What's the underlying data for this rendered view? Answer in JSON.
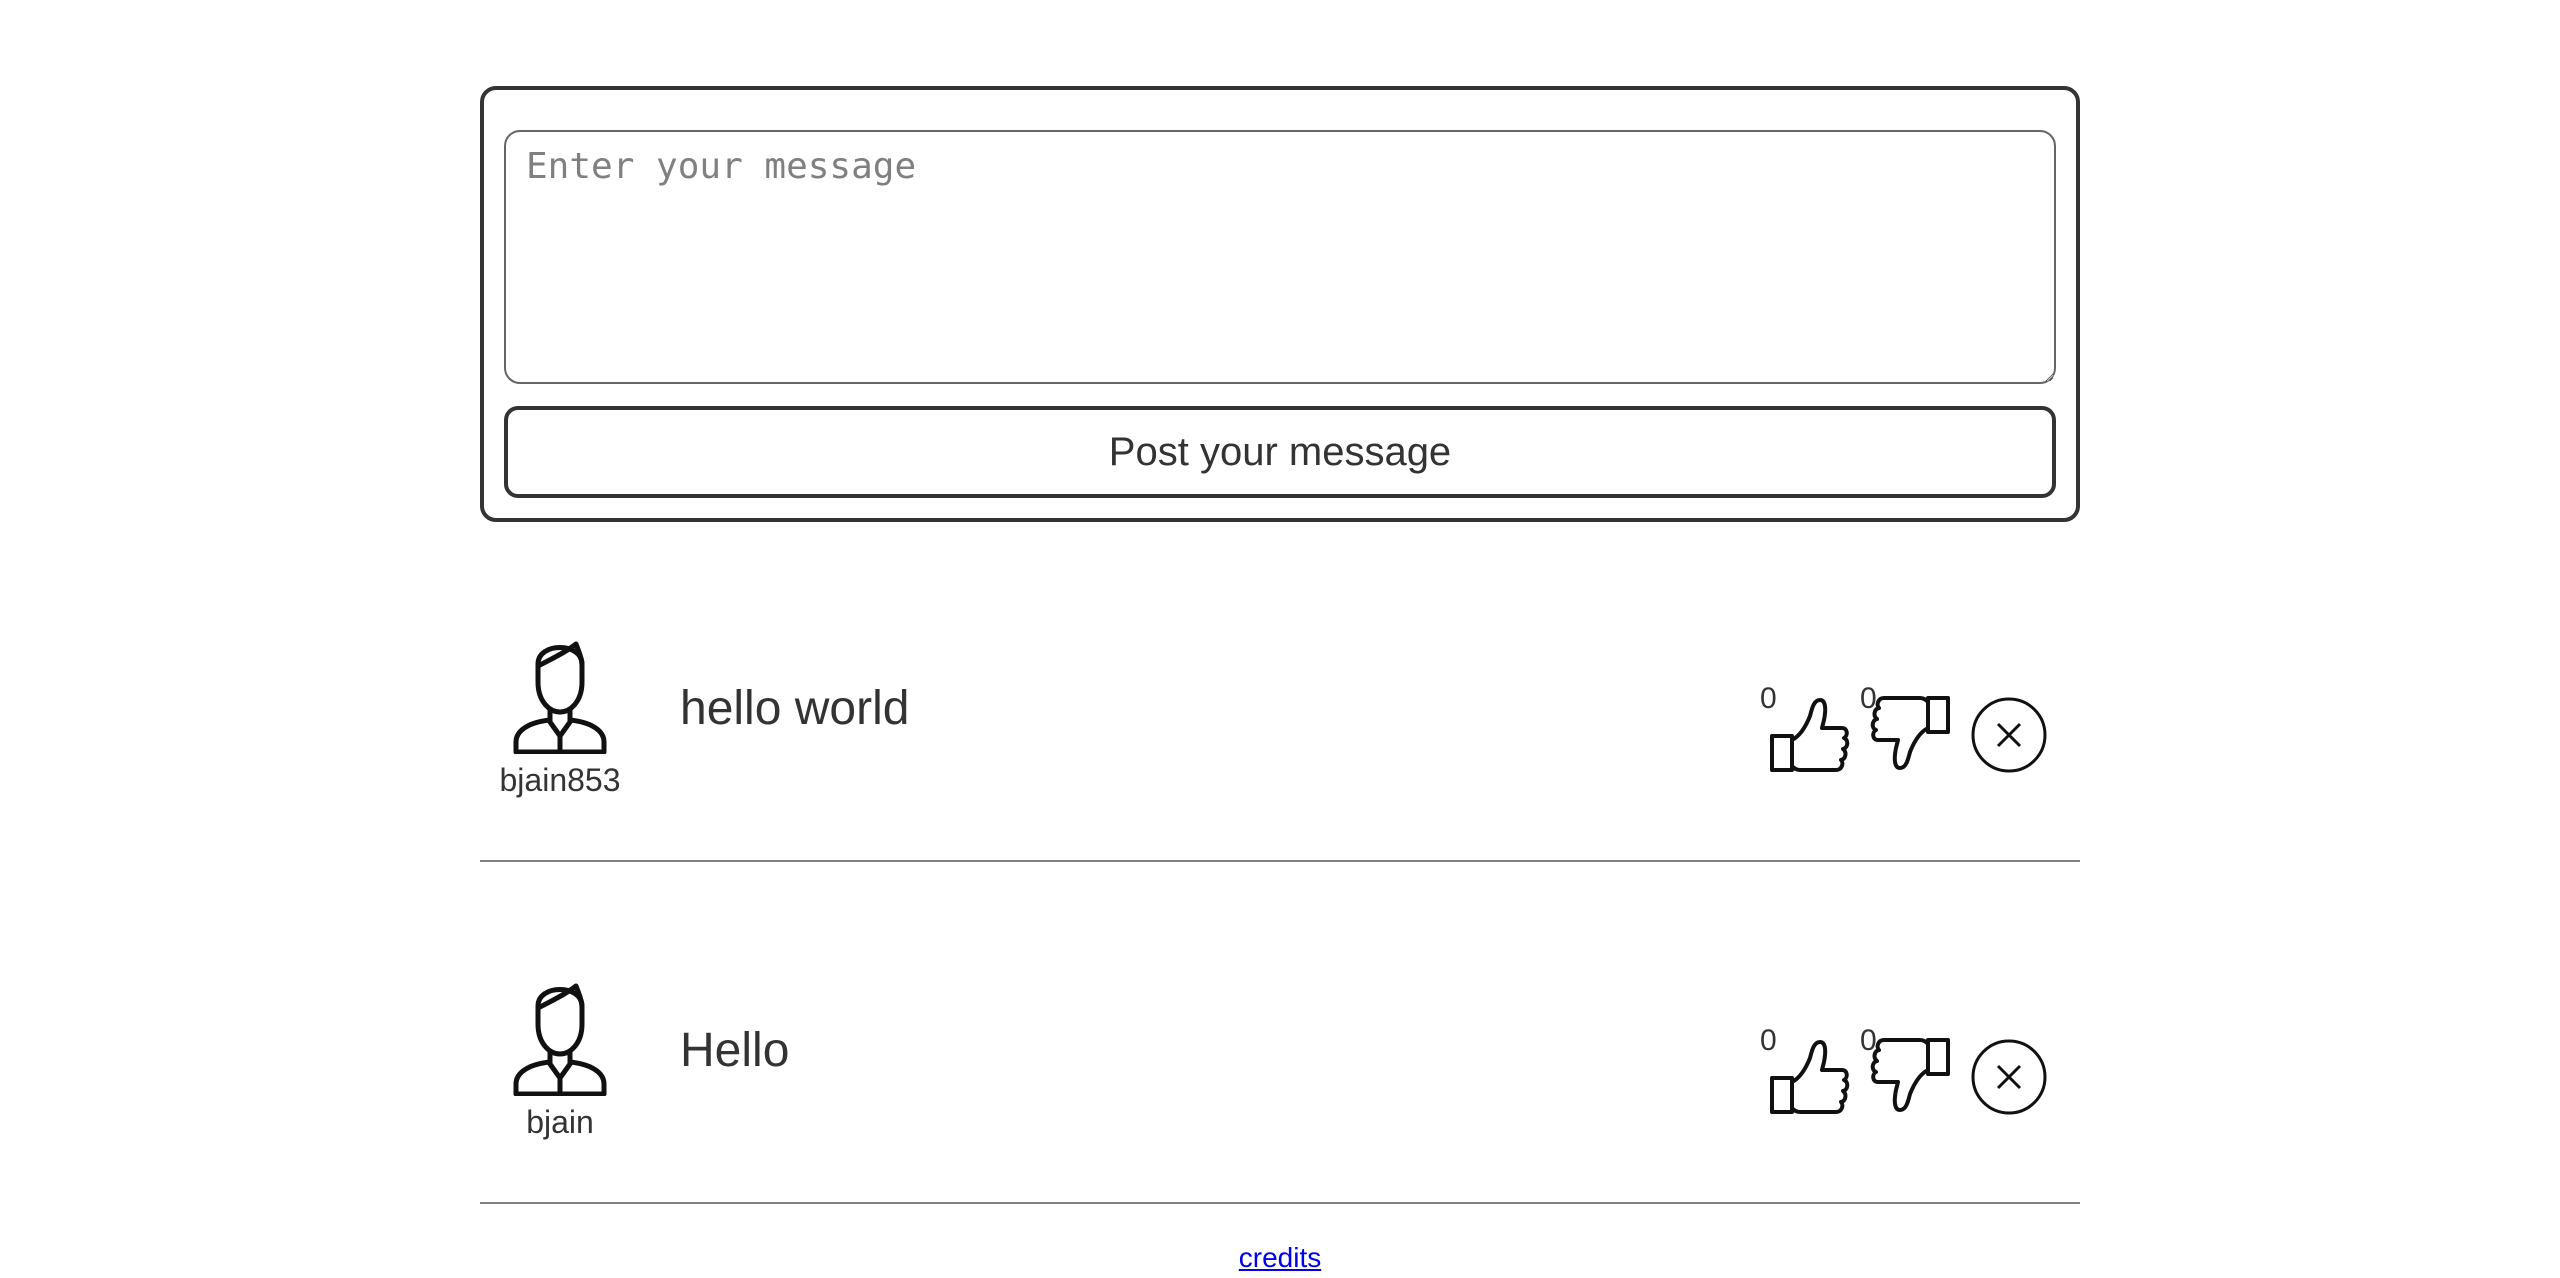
{
  "composer": {
    "placeholder": "Enter your message",
    "value": "",
    "post_label": "Post your message"
  },
  "messages": [
    {
      "author": "bjain853",
      "text": "hello world",
      "likes": "0",
      "dislikes": "0",
      "icons": {
        "avatar": "user-avatar-icon",
        "like": "thumbs-up-icon",
        "dislike": "thumbs-down-icon",
        "delete": "close-circle-icon"
      }
    },
    {
      "author": "bjain",
      "text": "Hello",
      "likes": "0",
      "dislikes": "0",
      "icons": {
        "avatar": "user-avatar-icon",
        "like": "thumbs-up-icon",
        "dislike": "thumbs-down-icon",
        "delete": "close-circle-icon"
      }
    }
  ],
  "footer": {
    "credits_label": "credits"
  },
  "colors": {
    "text": "#333333",
    "border": "#333333",
    "divider": "#808080",
    "placeholder": "#808080",
    "link": "#0000ee",
    "background": "#ffffff"
  }
}
